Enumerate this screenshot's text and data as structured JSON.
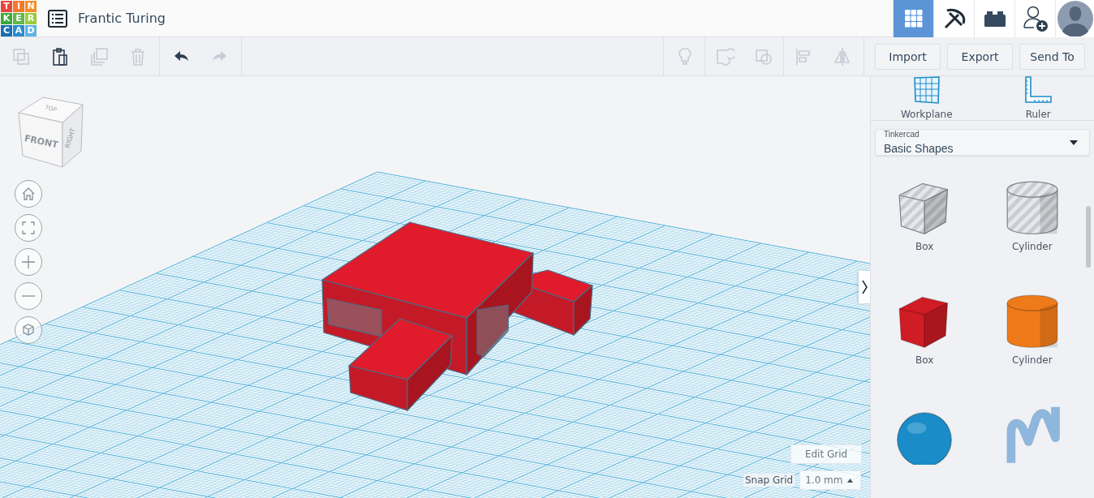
{
  "logo": {
    "letters": [
      {
        "char": "T",
        "color": "#e8453c"
      },
      {
        "char": "I",
        "color": "#f4782a"
      },
      {
        "char": "N",
        "color": "#f28f2b"
      },
      {
        "char": "K",
        "color": "#3ba83a"
      },
      {
        "char": "E",
        "color": "#62b846"
      },
      {
        "char": "R",
        "color": "#9ccb3b"
      },
      {
        "char": "C",
        "color": "#1a6fb5"
      },
      {
        "char": "A",
        "color": "#2a8bd0"
      },
      {
        "char": "D",
        "color": "#5db4e3"
      }
    ]
  },
  "design_title": "Frantic Turing",
  "header_buttons": [
    {
      "kind": "grid",
      "selected": true
    },
    {
      "kind": "pickaxe",
      "selected": false
    },
    {
      "kind": "brick",
      "selected": false
    },
    {
      "kind": "add-user",
      "selected": false
    },
    {
      "kind": "avatar",
      "selected": false
    }
  ],
  "toolbar": {
    "edit_tools": [
      {
        "kind": "copy",
        "disabled": true
      },
      {
        "kind": "paste",
        "disabled": false
      },
      {
        "kind": "duplicate",
        "disabled": true
      },
      {
        "kind": "delete",
        "disabled": true
      }
    ],
    "history_tools": [
      {
        "kind": "undo",
        "disabled": false
      },
      {
        "kind": "redo",
        "disabled": true
      }
    ],
    "shape_tools": [
      {
        "kind": "note",
        "disabled": true
      },
      {
        "kind": "group",
        "disabled": true
      },
      {
        "kind": "hole-group",
        "disabled": true
      },
      {
        "kind": "align",
        "disabled": true
      },
      {
        "kind": "mirror",
        "disabled": true
      }
    ],
    "actions": [
      "Import",
      "Export",
      "Send To"
    ]
  },
  "viewcube": {
    "top": "TOP",
    "front": "FRONT",
    "right": "RIGHT"
  },
  "view_controls": [
    {
      "kind": "home"
    },
    {
      "kind": "fit"
    },
    {
      "kind": "zoom-in"
    },
    {
      "kind": "zoom-out"
    },
    {
      "kind": "ortho"
    }
  ],
  "edit_grid": "Edit Grid",
  "snap_grid": {
    "label": "Snap Grid",
    "value": "1.0 mm"
  },
  "panel": {
    "tools": [
      {
        "kind": "workplane",
        "label": "Workplane"
      },
      {
        "kind": "ruler",
        "label": "Ruler"
      }
    ],
    "library": {
      "source": "Tinkercad",
      "name": "Basic Shapes"
    },
    "shapes": [
      {
        "kind": "box",
        "hole": true,
        "label": "Box"
      },
      {
        "kind": "cylinder",
        "hole": true,
        "label": "Cylinder"
      },
      {
        "kind": "box",
        "hole": false,
        "color": "#d01c25",
        "label": "Box"
      },
      {
        "kind": "cylinder",
        "hole": false,
        "color": "#ef7a1a",
        "label": "Cylinder"
      },
      {
        "kind": "sphere",
        "hole": false,
        "color": "#1a8cc8"
      },
      {
        "kind": "scribble",
        "hole": false,
        "color": "#8fb6dc"
      }
    ]
  }
}
